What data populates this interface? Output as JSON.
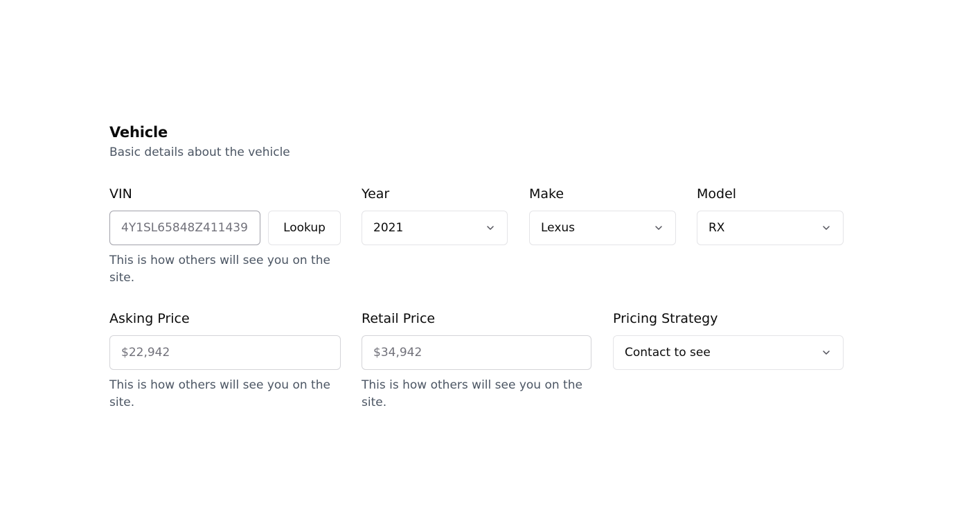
{
  "section": {
    "title": "Vehicle",
    "description": "Basic details about the vehicle"
  },
  "vin": {
    "label": "VIN",
    "placeholder": "4Y1SL65848Z411439",
    "value": "",
    "lookup_label": "Lookup",
    "help": "This is how others will see you on the site."
  },
  "year": {
    "label": "Year",
    "selected": "2021",
    "icon": "chevron-down-icon"
  },
  "make": {
    "label": "Make",
    "selected": "Lexus",
    "icon": "chevron-down-icon"
  },
  "model": {
    "label": "Model",
    "selected": "RX",
    "icon": "chevron-down-icon"
  },
  "asking_price": {
    "label": "Asking Price",
    "placeholder": "$22,942",
    "value": "",
    "help": "This is how others will see you on the site."
  },
  "retail_price": {
    "label": "Retail Price",
    "placeholder": "$34,942",
    "value": "",
    "help": "This is how others will see you on the site."
  },
  "pricing_strategy": {
    "label": "Pricing Strategy",
    "selected": "Contact to see",
    "icon": "chevron-down-icon"
  },
  "colors": {
    "text": "#0a0a0a",
    "muted": "#4b5563",
    "border": "#e4e4e7",
    "placeholder": "#71717a"
  }
}
